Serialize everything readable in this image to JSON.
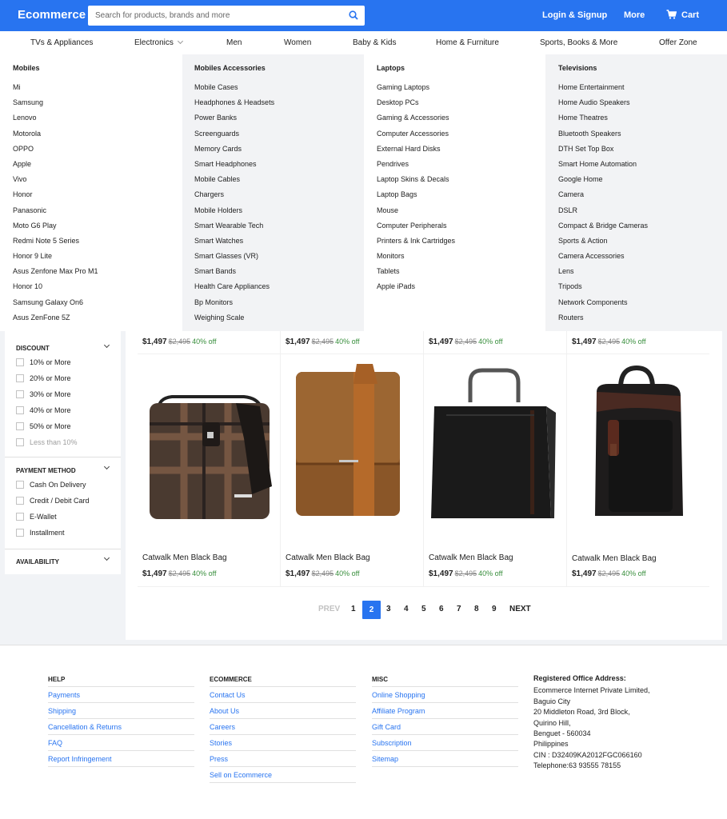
{
  "header": {
    "logo": "Ecommerce",
    "search_placeholder": "Search for products, brands and more",
    "login": "Login & Signup",
    "more": "More",
    "cart": "Cart"
  },
  "nav": [
    "TVs & Appliances",
    "Electronics",
    "Men",
    "Women",
    "Baby & Kids",
    "Home & Furniture",
    "Sports, Books & More",
    "Offer Zone"
  ],
  "mega": {
    "mobiles": {
      "title": "Mobiles",
      "items": [
        "Mi",
        "Samsung",
        "Lenovo",
        "Motorola",
        "OPPO",
        "Apple",
        "Vivo",
        "Honor",
        "Panasonic",
        "Moto G6 Play",
        "Redmi Note 5 Series",
        "Honor 9 Lite",
        "Asus Zenfone Max Pro M1",
        "Honor 10",
        "Samsung Galaxy On6",
        "Asus ZenFone 5Z"
      ]
    },
    "accessories": {
      "title": "Mobiles Accessories",
      "items": [
        "Mobile Cases",
        "Headphones & Headsets",
        "Power Banks",
        "Screenguards",
        "Memory Cards",
        "Smart Headphones",
        "Mobile Cables",
        "Chargers",
        "Mobile Holders",
        "Smart Wearable Tech",
        "Smart Watches",
        "Smart Glasses (VR)",
        "Smart Bands",
        "Health Care Appliances",
        "Bp Monitors",
        "Weighing Scale"
      ]
    },
    "laptops": {
      "title": "Laptops",
      "items": [
        "Gaming Laptops",
        "Desktop PCs",
        "Gaming & Accessories",
        "Computer Accessories",
        "External Hard Disks",
        "Pendrives",
        "Laptop Skins & Decals",
        "Laptop Bags",
        "Mouse",
        "Computer Peripherals",
        "Printers & Ink Cartridges",
        "Monitors",
        "Tablets",
        "Apple iPads"
      ]
    },
    "televisions": {
      "title": "Televisions",
      "items": [
        "Home Entertainment",
        "Home Audio Speakers",
        "Home Theatres",
        "Bluetooth Speakers",
        "DTH Set Top Box",
        "Smart Home Automation",
        "Google Home",
        "Camera",
        "DSLR",
        "Compact & Bridge Cameras",
        "Sports & Action",
        "Camera Accessories",
        "Lens",
        "Tripods",
        "Network Components",
        "Routers"
      ]
    }
  },
  "filters": {
    "discount": {
      "title": "DISCOUNT",
      "options": [
        "10% or More",
        "20% or More",
        "30% or More",
        "40% or More",
        "50% or More",
        "Less than 10%"
      ]
    },
    "payment": {
      "title": "PAYMENT METHOD",
      "options": [
        "Cash On Delivery",
        "Credit / Debit Card",
        "E-Wallet",
        "Installment"
      ]
    },
    "availability": {
      "title": "AVAILABILITY"
    }
  },
  "products_top": [
    {
      "price": "$1,497",
      "old": "$2,495",
      "off": "40% off"
    },
    {
      "price": "$1,497",
      "old": "$2,495",
      "off": "40% off"
    },
    {
      "price": "$1,497",
      "old": "$2,495",
      "off": "40% off"
    },
    {
      "price": "$1,497",
      "old": "$2,495",
      "off": "40% off"
    }
  ],
  "products": [
    {
      "name": "Catwalk Men Black Bag",
      "price": "$1,497",
      "old": "$2,495",
      "off": "40% off"
    },
    {
      "name": "Catwalk Men Black Bag",
      "price": "$1,497",
      "old": "$2,495",
      "off": "40% off"
    },
    {
      "name": "Catwalk Men Black Bag",
      "price": "$1,497",
      "old": "$2,495",
      "off": "40% off"
    },
    {
      "name": "Catwalk Men Black Bag",
      "price": "$1,497",
      "old": "$2,495",
      "off": "40% off"
    }
  ],
  "pagination": {
    "prev": "PREV",
    "pages": [
      "1",
      "2",
      "3",
      "4",
      "5",
      "6",
      "7",
      "8",
      "9"
    ],
    "current": "2",
    "next": "NEXT"
  },
  "footer": {
    "help": {
      "title": "HELP",
      "links": [
        "Payments",
        "Shipping",
        "Cancellation & Returns",
        "FAQ",
        "Report Infringement"
      ]
    },
    "ecommerce": {
      "title": "ECOMMERCE",
      "links": [
        "Contact Us",
        "About Us",
        "Careers",
        "Stories",
        "Press",
        "Sell on Ecommerce"
      ]
    },
    "misc": {
      "title": "MISC",
      "links": [
        "Online Shopping",
        "Affiliate Program",
        "Gift Card",
        "Subscription",
        "Sitemap"
      ]
    },
    "address": {
      "title": "Registered Office Address:",
      "lines": [
        "Ecommerce Internet Private Limited,",
        "Baguio City",
        "20 Middleton Road, 3rd Block,",
        "Quirino Hill,",
        "Benguet - 560034",
        "Philippines",
        "CIN : D32409KA2012FGC066160",
        "Telephone:63 93555 78155"
      ]
    }
  },
  "colors": {
    "brand": "#2874f0",
    "discount_green": "#388e3c"
  }
}
